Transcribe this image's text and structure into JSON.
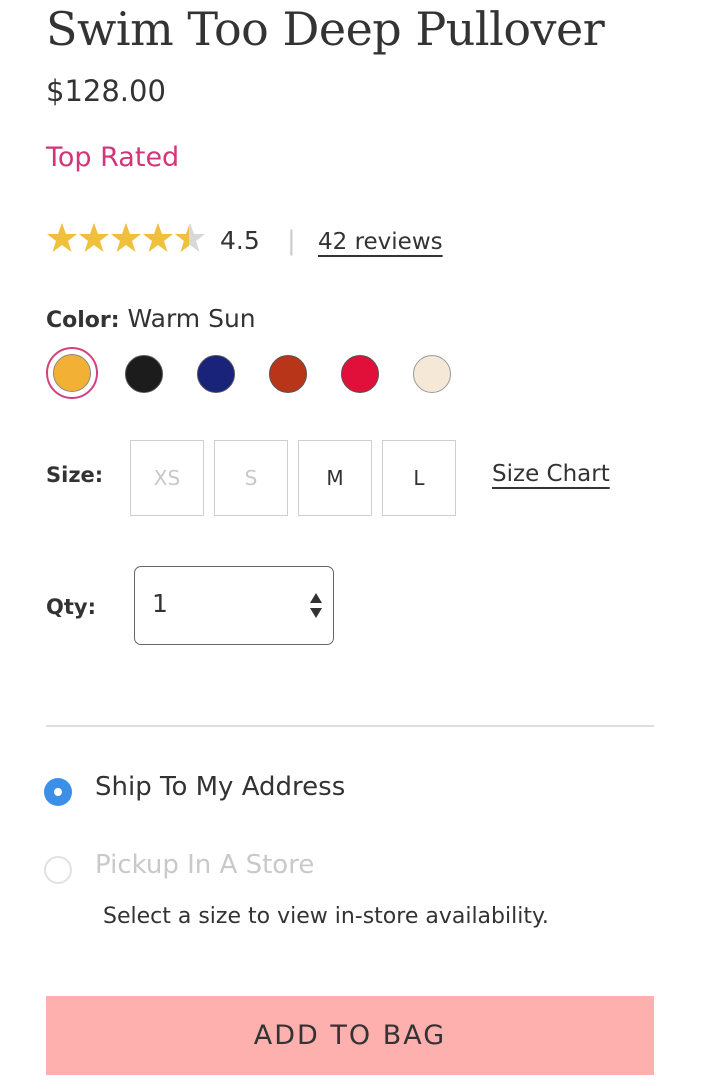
{
  "product": {
    "title": "Swim Too Deep Pullover",
    "price": "$128.00",
    "badge": "Top Rated",
    "badge_color": "#d2357a"
  },
  "rating": {
    "value_text": "4.5",
    "value": 4.5,
    "max": 5,
    "separator": "|",
    "reviews_label": "42 reviews",
    "star_color": "#f0bf3c",
    "empty_star_color": "#d8d8d8"
  },
  "color": {
    "label": "Color:",
    "selected_name": "Warm Sun",
    "swatches": [
      {
        "name": "warm-sun",
        "hex": "#f2b035",
        "selected": true
      },
      {
        "name": "black",
        "hex": "#1c1c1c",
        "selected": false
      },
      {
        "name": "navy",
        "hex": "#19237a",
        "selected": false
      },
      {
        "name": "rust",
        "hex": "#b8351a",
        "selected": false
      },
      {
        "name": "red",
        "hex": "#e0103a",
        "selected": false
      },
      {
        "name": "cream",
        "hex": "#f5e8d6",
        "selected": false
      }
    ]
  },
  "size": {
    "label": "Size:",
    "options": [
      {
        "label": "XS",
        "available": false
      },
      {
        "label": "S",
        "available": false
      },
      {
        "label": "M",
        "available": true
      },
      {
        "label": "L",
        "available": true
      }
    ],
    "chart_link": "Size Chart"
  },
  "qty": {
    "label": "Qty:",
    "value": "1"
  },
  "fulfillment": {
    "ship_label": "Ship To My Address",
    "pickup_label": "Pickup In A Store",
    "availability_msg": "Select a size to view in-store availability.",
    "selected": "ship",
    "accent_color": "#3b8fe6"
  },
  "cta": {
    "add_to_bag": "ADD TO BAG",
    "bg_color": "#feb0af"
  }
}
